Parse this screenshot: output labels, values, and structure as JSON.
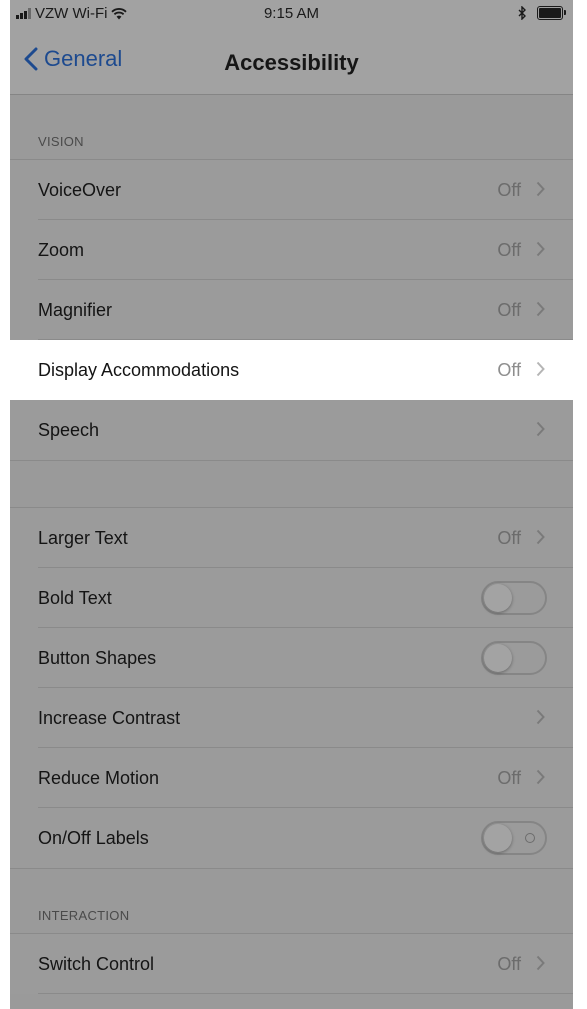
{
  "status_bar": {
    "carrier": "VZW Wi-Fi",
    "time": "9:15 AM",
    "icons": [
      "signal-icon",
      "wifi-icon",
      "bluetooth-icon",
      "battery-icon"
    ]
  },
  "nav": {
    "back_label": "General",
    "title": "Accessibility"
  },
  "sections": {
    "vision": "VISION",
    "interaction": "INTERACTION"
  },
  "vision_rows": [
    {
      "label": "VoiceOver",
      "value": "Off"
    },
    {
      "label": "Zoom",
      "value": "Off"
    },
    {
      "label": "Magnifier",
      "value": "Off"
    },
    {
      "label": "Display Accommodations",
      "value": "Off",
      "highlighted": true
    },
    {
      "label": "Speech",
      "value": ""
    }
  ],
  "text_rows": [
    {
      "label": "Larger Text",
      "value": "Off",
      "type": "disclosure"
    },
    {
      "label": "Bold Text",
      "type": "toggle",
      "on": false
    },
    {
      "label": "Button Shapes",
      "type": "toggle",
      "on": false
    },
    {
      "label": "Increase Contrast",
      "value": "",
      "type": "disclosure"
    },
    {
      "label": "Reduce Motion",
      "value": "Off",
      "type": "disclosure"
    },
    {
      "label": "On/Off Labels",
      "type": "toggle",
      "on": false
    }
  ],
  "interaction_rows": [
    {
      "label": "Switch Control",
      "value": "Off"
    }
  ],
  "colors": {
    "dim_background": "#9a9a9a",
    "highlight_row": "#ffffff",
    "link_blue": "#1d4a8f"
  }
}
